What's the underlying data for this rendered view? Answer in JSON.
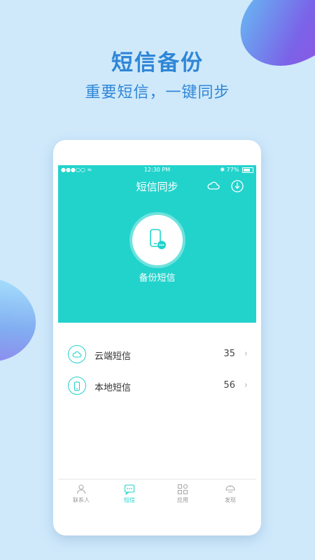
{
  "promo": {
    "title": "短信备份",
    "subtitle": "重要短信，一键同步"
  },
  "status_bar": {
    "signal": "●●●○○",
    "wifi": "≈",
    "time": "12:30 PM",
    "bluetooth": "✱",
    "battery": "77%"
  },
  "screen": {
    "title": "短信同步",
    "backup_label": "备份短信",
    "icons": {
      "cloud": "cloud-icon",
      "sync": "sync-icon",
      "backup": "phone-message-icon"
    }
  },
  "list": [
    {
      "label": "云端短信",
      "count": "35",
      "icon": "cloud-icon"
    },
    {
      "label": "本地短信",
      "count": "56",
      "icon": "phone-icon"
    }
  ],
  "tabs": [
    {
      "label": "联系人",
      "icon": "person-icon",
      "active": false
    },
    {
      "label": "短信",
      "icon": "message-icon",
      "active": true
    },
    {
      "label": "应用",
      "icon": "apps-icon",
      "active": false
    },
    {
      "label": "发现",
      "icon": "discover-icon",
      "active": false
    }
  ],
  "colors": {
    "background": "#cfe9fb",
    "headline": "#2f86d6",
    "accent": "#22d3cc"
  }
}
